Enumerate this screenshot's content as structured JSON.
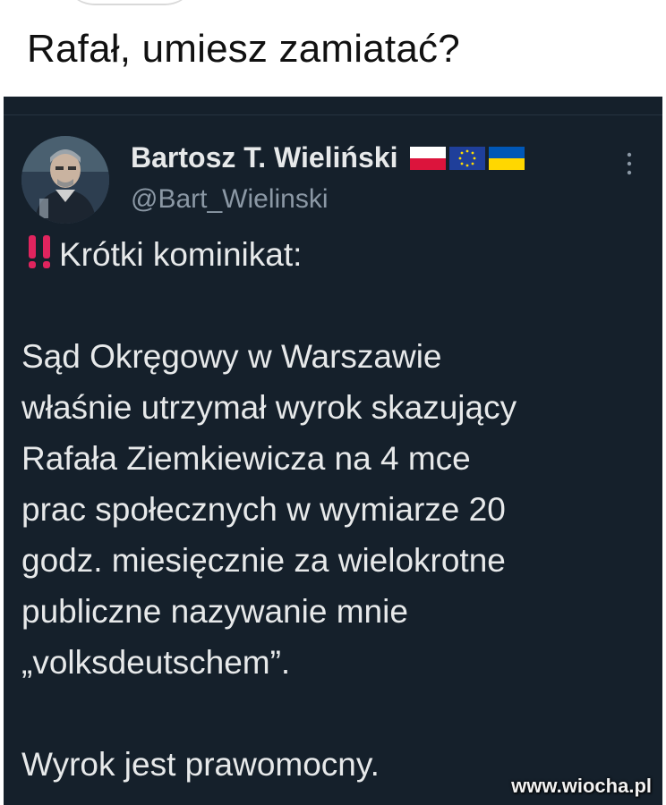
{
  "caption": "Rafał, umiesz zamiatać?",
  "tweet": {
    "display_name": "Bartosz T. Wieliński",
    "handle": "@Bart_Wielinski",
    "flags": [
      "poland-flag",
      "eu-flag",
      "ukraine-flag"
    ],
    "more_icon": "vertical-ellipsis-icon",
    "exclamation_icon": "double-exclamation-icon",
    "lines": {
      "l1": "Krótki kominikat:",
      "l2": "Sąd Okręgowy w Warszawie",
      "l3": "właśnie utrzymał wyrok skazujący",
      "l4": "Rafała Ziemkiewicza na 4 mce",
      "l5": "prac społecznych w wymiarze 20",
      "l6": "godz. miesięcznie za wielokrotne",
      "l7": "publiczne nazywanie mnie",
      "l8": "„volksdeutschem”.",
      "l9": "Wyrok jest prawomocny."
    }
  },
  "watermark": "www.wiocha.pl",
  "colors": {
    "tweet_bg": "#15202b",
    "text": "#e7e9ea",
    "handle": "#8b98a5",
    "exclamation": "#e0245e"
  }
}
